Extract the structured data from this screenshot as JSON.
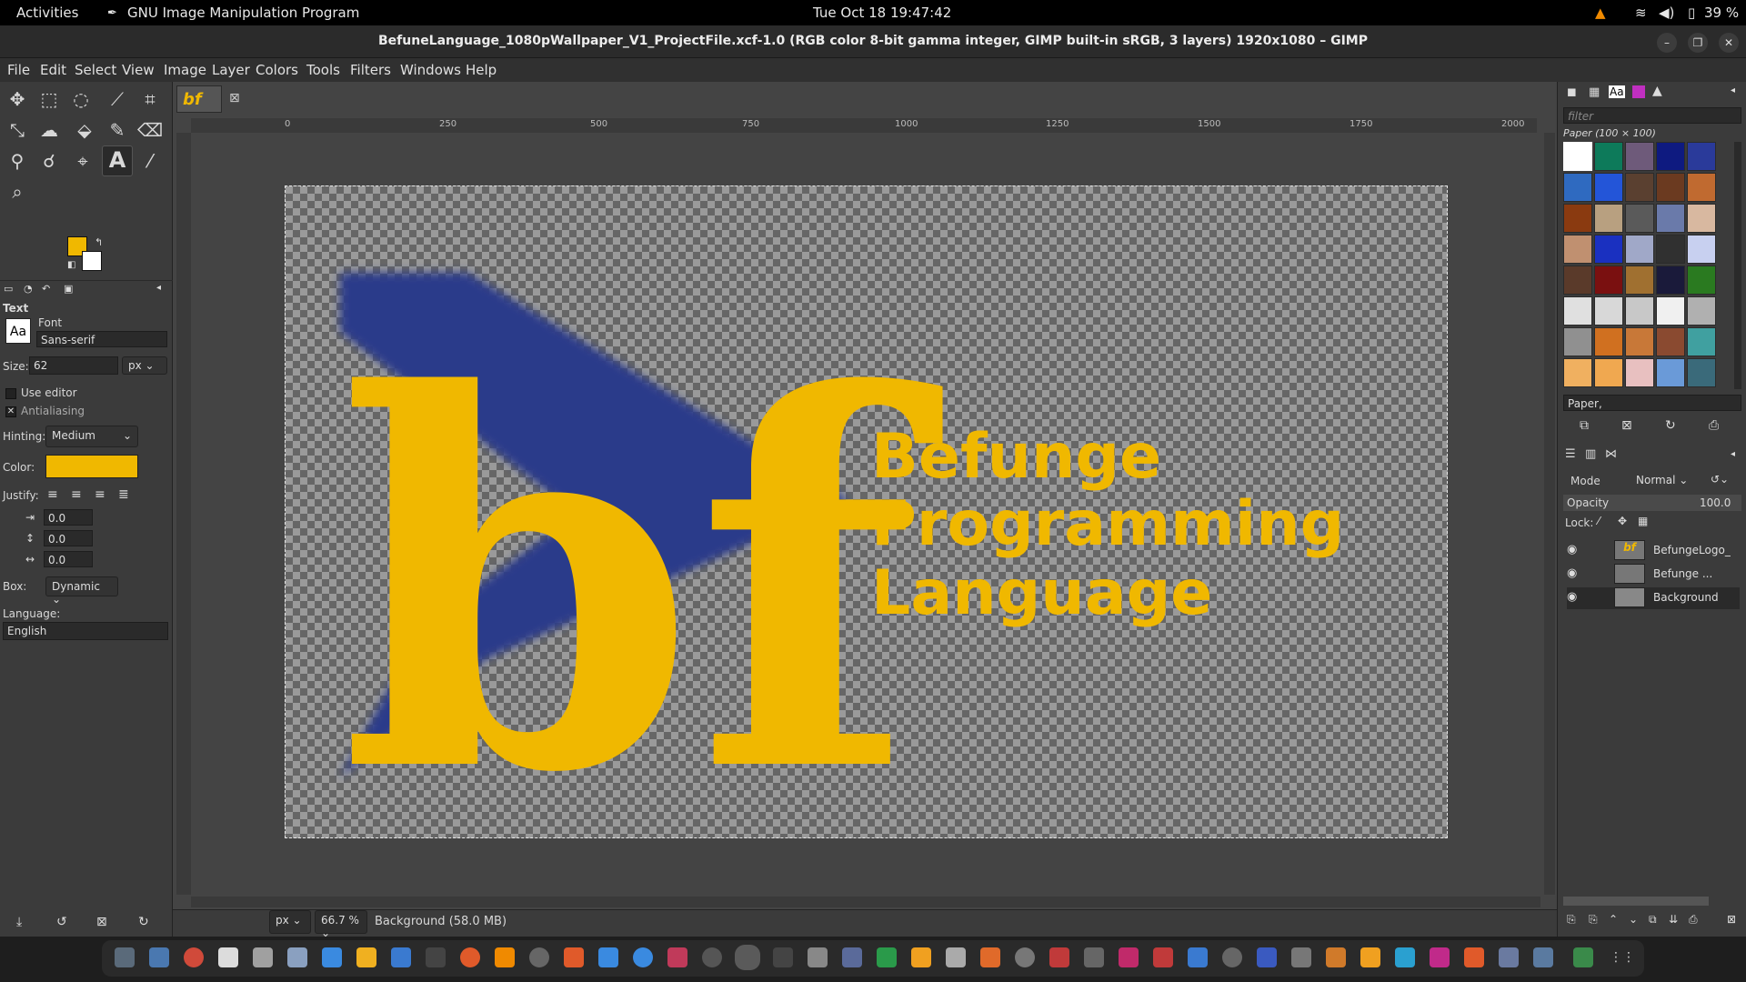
{
  "topbar": {
    "activities": "Activities",
    "app_name": "GNU Image Manipulation Program",
    "datetime": "Tue Oct 18  19:47:42",
    "battery": "39 %"
  },
  "window": {
    "title": "BefuneLanguage_1080pWallpaper_V1_ProjectFile.xcf-1.0 (RGB color 8-bit gamma integer, GIMP built-in sRGB, 3 layers) 1920x1080 – GIMP"
  },
  "menu": [
    "File",
    "Edit",
    "Select",
    "View",
    "Image",
    "Layer",
    "Colors",
    "Tools",
    "Filters",
    "Windows",
    "Help"
  ],
  "tool_options": {
    "section": "Text",
    "font_label": "Font",
    "font_value": "Sans-serif",
    "size_label": "Size:",
    "size_value": "62",
    "size_unit": "px",
    "use_editor": "Use editor",
    "antialiasing": "Antialiasing",
    "hinting_label": "Hinting:",
    "hinting_value": "Medium",
    "color_label": "Color:",
    "color_value": "#f0b800",
    "justify_label": "Justify:",
    "indent": "0.0",
    "line_spacing": "0.0",
    "letter_spacing": "0.0",
    "box_label": "Box:",
    "box_value": "Dynamic",
    "language_label": "Language:",
    "language_value": "English"
  },
  "rulers": {
    "h_ticks": [
      "0",
      "250",
      "500",
      "750",
      "1000",
      "1250",
      "1500",
      "1750",
      "2000"
    ]
  },
  "canvas": {
    "logo_text": "bf",
    "headline_lines": [
      "Befunge",
      "Programming",
      "Language"
    ],
    "text_color": "#f0b800",
    "arrow_color": "#2b3a8a"
  },
  "patterns": {
    "filter_placeholder": "filter",
    "header": "Paper (100 × 100)",
    "selected_name": "Paper,"
  },
  "layers": {
    "mode_label": "Mode",
    "mode_value": "Normal",
    "opacity_label": "Opacity",
    "opacity_value": "100.0",
    "lock_label": "Lock:",
    "items": [
      {
        "name": "BefungeLogo_"
      },
      {
        "name": "Befunge ..."
      },
      {
        "name": "Background"
      }
    ]
  },
  "status": {
    "unit": "px",
    "zoom": "66.7 %",
    "info": "Background (58.0 MB)"
  }
}
